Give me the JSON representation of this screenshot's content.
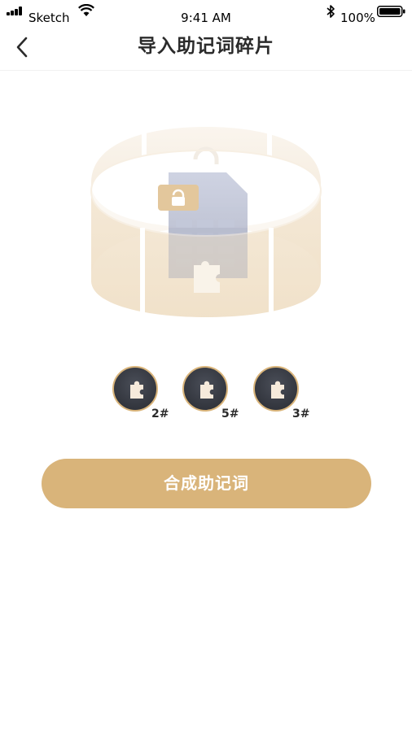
{
  "status_bar": {
    "carrier": "Sketch",
    "time": "9:41 AM",
    "battery": "100%"
  },
  "nav": {
    "title": "导入助记词碎片"
  },
  "fragments": [
    {
      "label": "2#"
    },
    {
      "label": "5#"
    },
    {
      "label": "3#"
    }
  ],
  "actions": {
    "combine_label": "合成助记词"
  },
  "colors": {
    "accent": "#d9b47a",
    "fragment_bg": "#33363e",
    "title": "#2b2b2b"
  },
  "icons": {
    "back": "chevron-left-icon",
    "fragment": "puzzle-piece-icon",
    "lock": "lock-icon",
    "wifi": "wifi-icon",
    "bluetooth": "bluetooth-icon",
    "battery": "battery-icon"
  }
}
